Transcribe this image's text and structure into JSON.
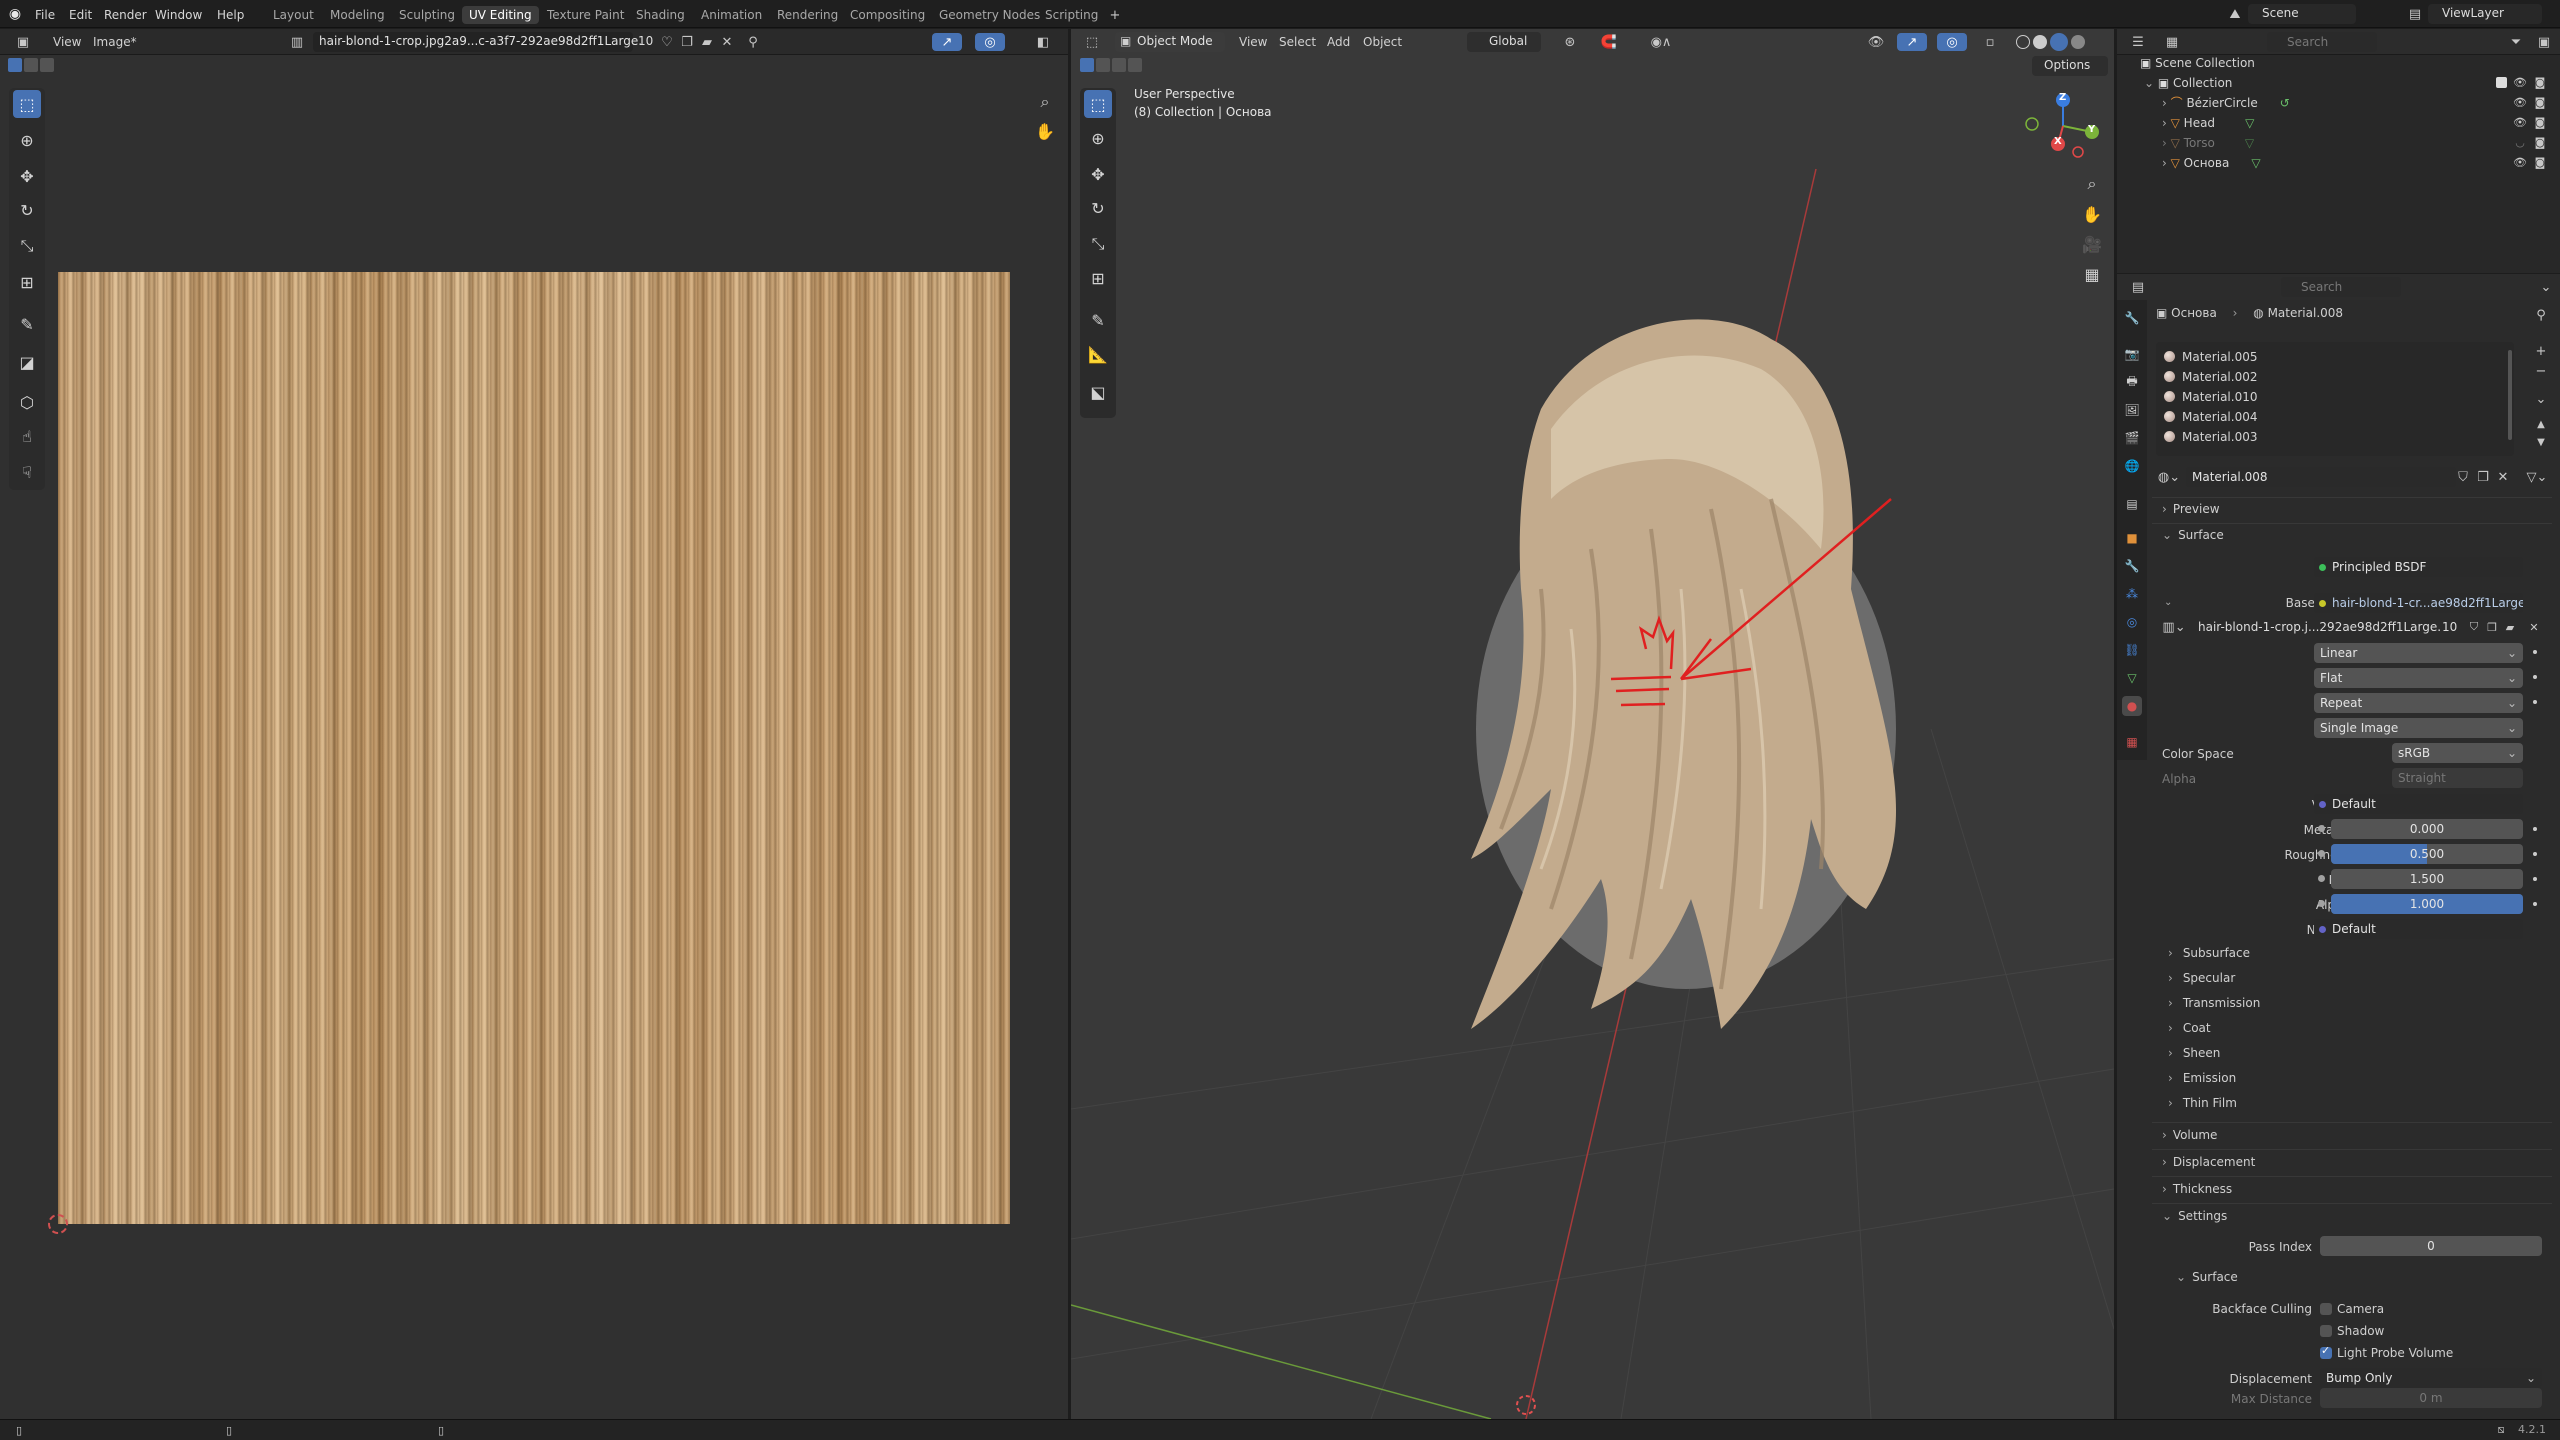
{
  "app_menu": [
    "File",
    "Edit",
    "Render",
    "Window",
    "Help"
  ],
  "workspaces": [
    "Layout",
    "Modeling",
    "Sculpting",
    "UV Editing",
    "Texture Paint",
    "Shading",
    "Animation",
    "Rendering",
    "Compositing",
    "Geometry Nodes",
    "Scripting"
  ],
  "active_workspace": "UV Editing",
  "scene": {
    "label": "Scene",
    "viewlayer": "ViewLayer"
  },
  "image_editor": {
    "menus": [
      "View",
      "Image*"
    ],
    "image_name": "hair-blond-1-crop.jpg2a9...c-a3f7-292ae98d2ff1Large.",
    "user_count": "10"
  },
  "viewport": {
    "mode": "Object Mode",
    "menus": [
      "View",
      "Select",
      "Add",
      "Object"
    ],
    "orientation": "Global",
    "options_label": "Options",
    "overlay_title": "User Perspective",
    "overlay_sub": "(8) Collection | Основа",
    "gizmo": {
      "z": "Z",
      "y": "Y",
      "x": "X"
    }
  },
  "outliner": {
    "search_placeholder": "Search",
    "root": "Scene Collection",
    "collection": "Collection",
    "items": [
      {
        "name": "BézierCircle",
        "dim": false
      },
      {
        "name": "Head",
        "dim": false
      },
      {
        "name": "Torso",
        "dim": true
      },
      {
        "name": "Основа",
        "dim": false
      }
    ]
  },
  "properties": {
    "search_placeholder": "Search",
    "breadcrumb": {
      "object": "Основа",
      "material": "Material.008"
    },
    "material_slots": [
      "Material.005",
      "Material.002",
      "Material.010",
      "Material.004",
      "Material.003"
    ],
    "material_name": "Material.008",
    "panels": {
      "preview": "Preview",
      "surface": "Surface"
    },
    "surface_label": "Surface",
    "surface_value": "Principled BSDF",
    "base_color_label": "Base Color",
    "base_color_value": "hair-blond-1-cr...ae98d2ff1Large.",
    "image_node_name": "hair-blond-1-crop.j...292ae98d2ff1Large.",
    "image_node_users": "10",
    "interp": "Linear",
    "projection": "Flat",
    "extension": "Repeat",
    "source": "Single Image",
    "color_space_label": "Color Space",
    "color_space_value": "sRGB",
    "alpha_label": "Alpha",
    "alpha_value": "Straight",
    "vector_label": "Vector",
    "vector_value": "Default",
    "metallic_label": "Metallic",
    "metallic_value": "0.000",
    "roughness_label": "Roughness",
    "roughness_value": "0.500",
    "roughness_fraction": 0.5,
    "ior_label": "IOR",
    "ior_value": "1.500",
    "alpha_socket_label": "Alpha",
    "alpha_socket_value": "1.000",
    "alpha_fraction": 1.0,
    "normal_label": "Normal",
    "normal_value": "Default",
    "subpanels": [
      "Subsurface",
      "Specular",
      "Transmission",
      "Coat",
      "Sheen",
      "Emission",
      "Thin Film"
    ],
    "sections": [
      "Volume",
      "Displacement",
      "Thickness",
      "Settings"
    ],
    "pass_index_label": "Pass Index",
    "pass_index_value": "0",
    "settings_surface": "Surface",
    "backface_label": "Backface Culling",
    "bf_camera": "Camera",
    "bf_shadow": "Shadow",
    "light_probe": "Light Probe Volume",
    "displacement_label": "Displacement",
    "displacement_value": "Bump Only",
    "max_distance_label": "Max Distance",
    "max_distance_value": "0 m"
  },
  "status": {
    "version": "4.2.1"
  },
  "colors": {
    "accent": "#4772b3",
    "annotation": "#e02020",
    "x_axis": "#e04848",
    "y_axis": "#7cb43a",
    "z_axis": "#3a7de0"
  }
}
